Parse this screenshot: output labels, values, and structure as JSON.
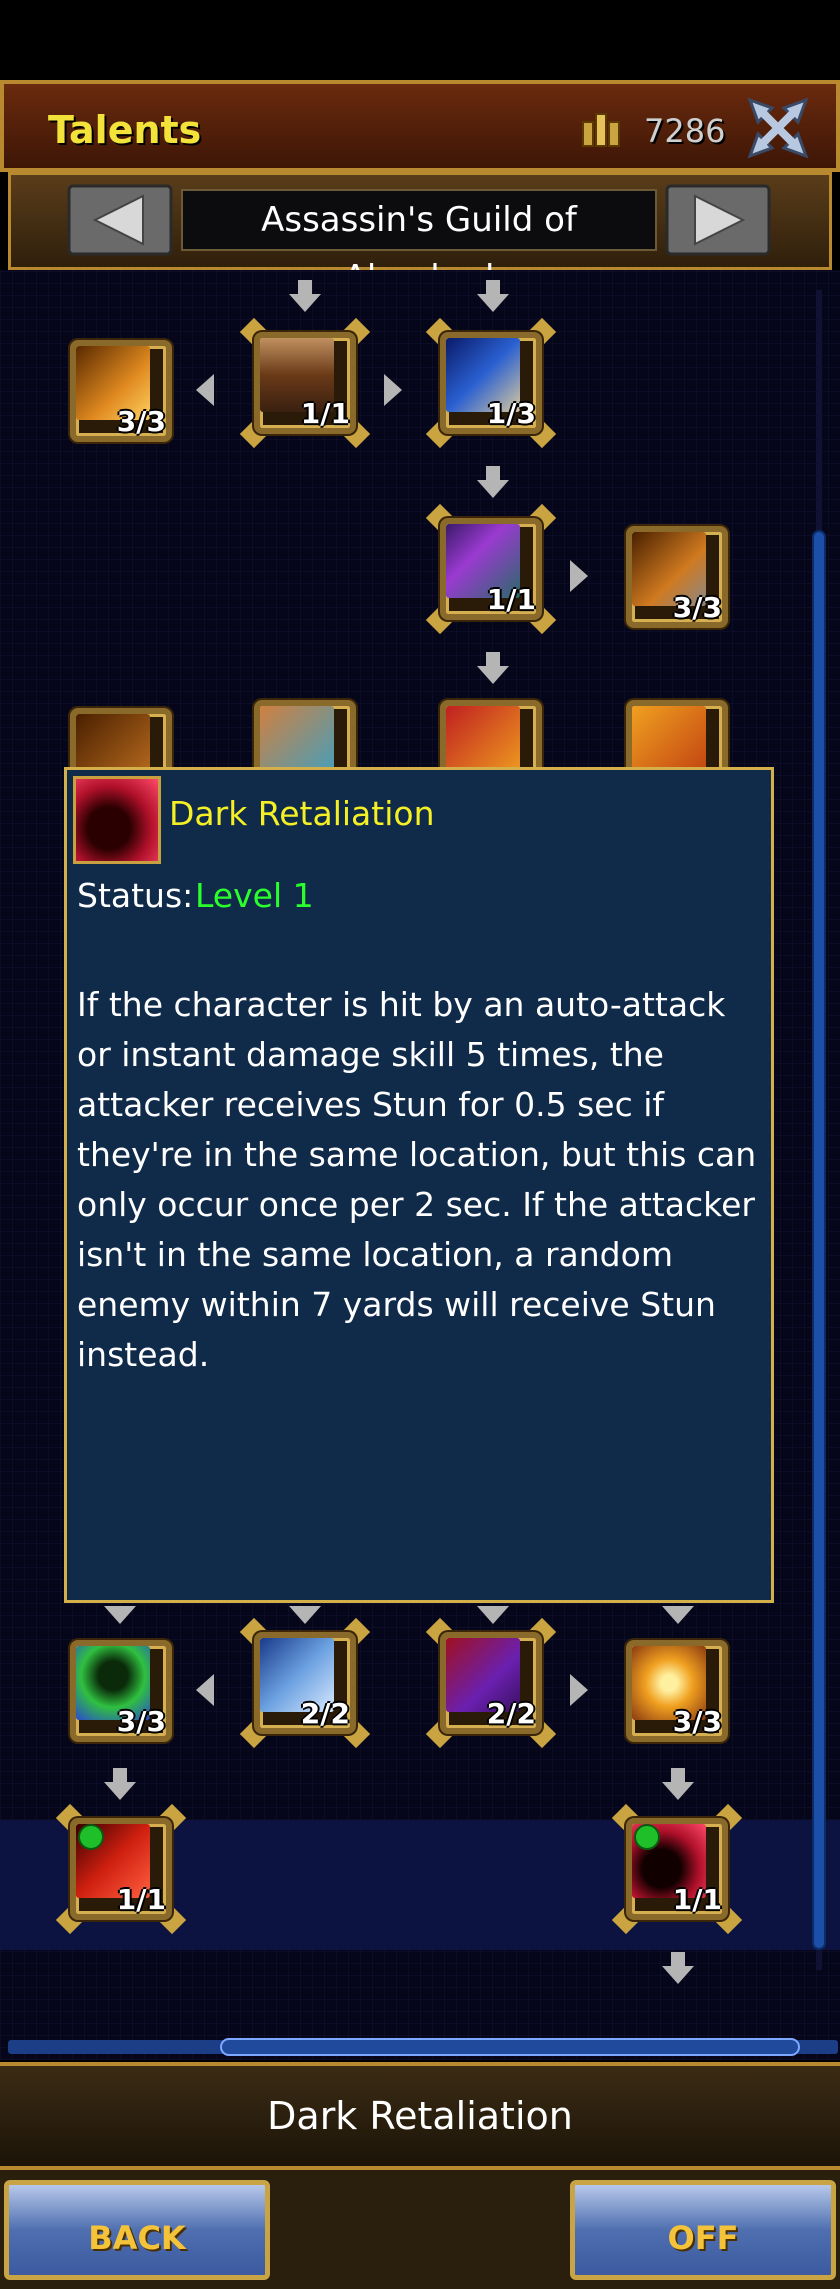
{
  "header": {
    "title": "Talents",
    "gold": "7286"
  },
  "tree": {
    "name": "Assassin's Guild of Almahad"
  },
  "nodes": {
    "r1_left": "3/3",
    "r1_mid": "1/1",
    "r1_right": "1/3",
    "r2_mid": "1/1",
    "r2_right": "3/3",
    "r6_a": "3/3",
    "r6_b": "2/2",
    "r6_c": "2/2",
    "r6_d": "3/3",
    "r7_left": "1/1",
    "r7_right": "1/1"
  },
  "tooltip": {
    "name": "Dark Retaliation",
    "status_label": "Status:",
    "status_value": "Level 1",
    "description": "If the character is hit by an auto-attack or instant damage skill 5 times, the attacker receives Stun for 0.5 sec if they're in the same location, but this can only occur once per 2 sec. If the attacker isn't in the same location, a random enemy within 7 yards will receive Stun instead."
  },
  "footer": {
    "selected_name": "Dark Retaliation",
    "back_label": "BACK",
    "off_label": "OFF"
  },
  "colors": {
    "title": "#f3e23a",
    "tooltip_name": "#f5ef25",
    "status_value": "#2bff2b",
    "button_text": "#f5c33a"
  }
}
